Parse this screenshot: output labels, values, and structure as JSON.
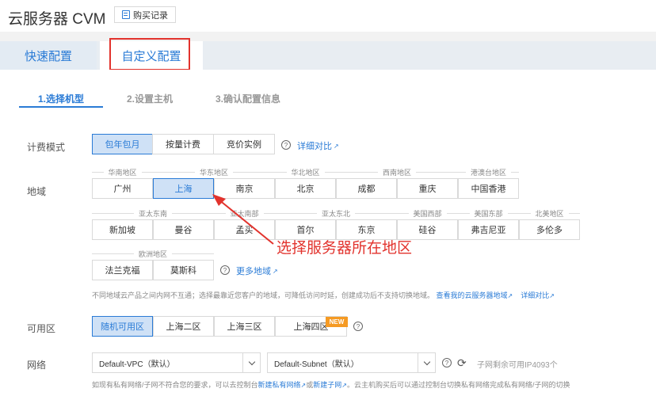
{
  "header": {
    "title": "云服务器 CVM",
    "purchase_record": "购买记录"
  },
  "tabs": {
    "quick": "快速配置",
    "custom": "自定义配置"
  },
  "steps": [
    "1.选择机型",
    "2.设置主机",
    "3.确认配置信息"
  ],
  "billing": {
    "label": "计费模式",
    "options": [
      "包年包月",
      "按量计费",
      "竞价实例"
    ],
    "selected": "包年包月",
    "detail_link": "详细对比"
  },
  "region": {
    "label": "地域",
    "groups": [
      "华南地区",
      "华东地区",
      "华北地区",
      "西南地区",
      "港澳台地区",
      "亚太东南",
      "亚太南部",
      "亚太东北",
      "美国西部",
      "美国东部",
      "北美地区",
      "欧洲地区"
    ],
    "options": [
      "广州",
      "上海",
      "南京",
      "北京",
      "成都",
      "重庆",
      "中国香港",
      "新加坡",
      "曼谷",
      "孟买",
      "首尔",
      "东京",
      "硅谷",
      "弗吉尼亚",
      "多伦多",
      "法兰克福",
      "莫斯科"
    ],
    "selected": "上海",
    "more_link": "更多地域",
    "note": "不同地域云产品之间内网不互通；选择最靠近您客户的地域，可降低访问时延，创建成功后不支持切换地域。",
    "note_link1": "查看我的云服务器地域",
    "note_link2": "详细对比"
  },
  "zone": {
    "label": "可用区",
    "options": [
      "随机可用区",
      "上海二区",
      "上海三区",
      "上海四区"
    ],
    "selected": "随机可用区",
    "new_badge": "NEW"
  },
  "network": {
    "label": "网络",
    "vpc": "Default-VPC（默认）",
    "subnet": "Default-Subnet（默认）",
    "remaining": "子网剩余可用IP4093个",
    "note_prefix": "如现有私有网络/子网不符合您的要求，可以去控制台",
    "note_link1": "新建私有网络",
    "note_or": "或",
    "note_link2": "新建子网",
    "note_suffix": "。云主机购买后可以通过控制台切换私有网络完成私有网络/子网的切换"
  },
  "annotation": {
    "text": "选择服务器所在地区",
    "color": "#e2332d"
  },
  "colors": {
    "accent": "#2a7bd6",
    "selected_bg": "#cfe1f6",
    "highlight": "#e2332d",
    "badge": "#f59a23"
  }
}
